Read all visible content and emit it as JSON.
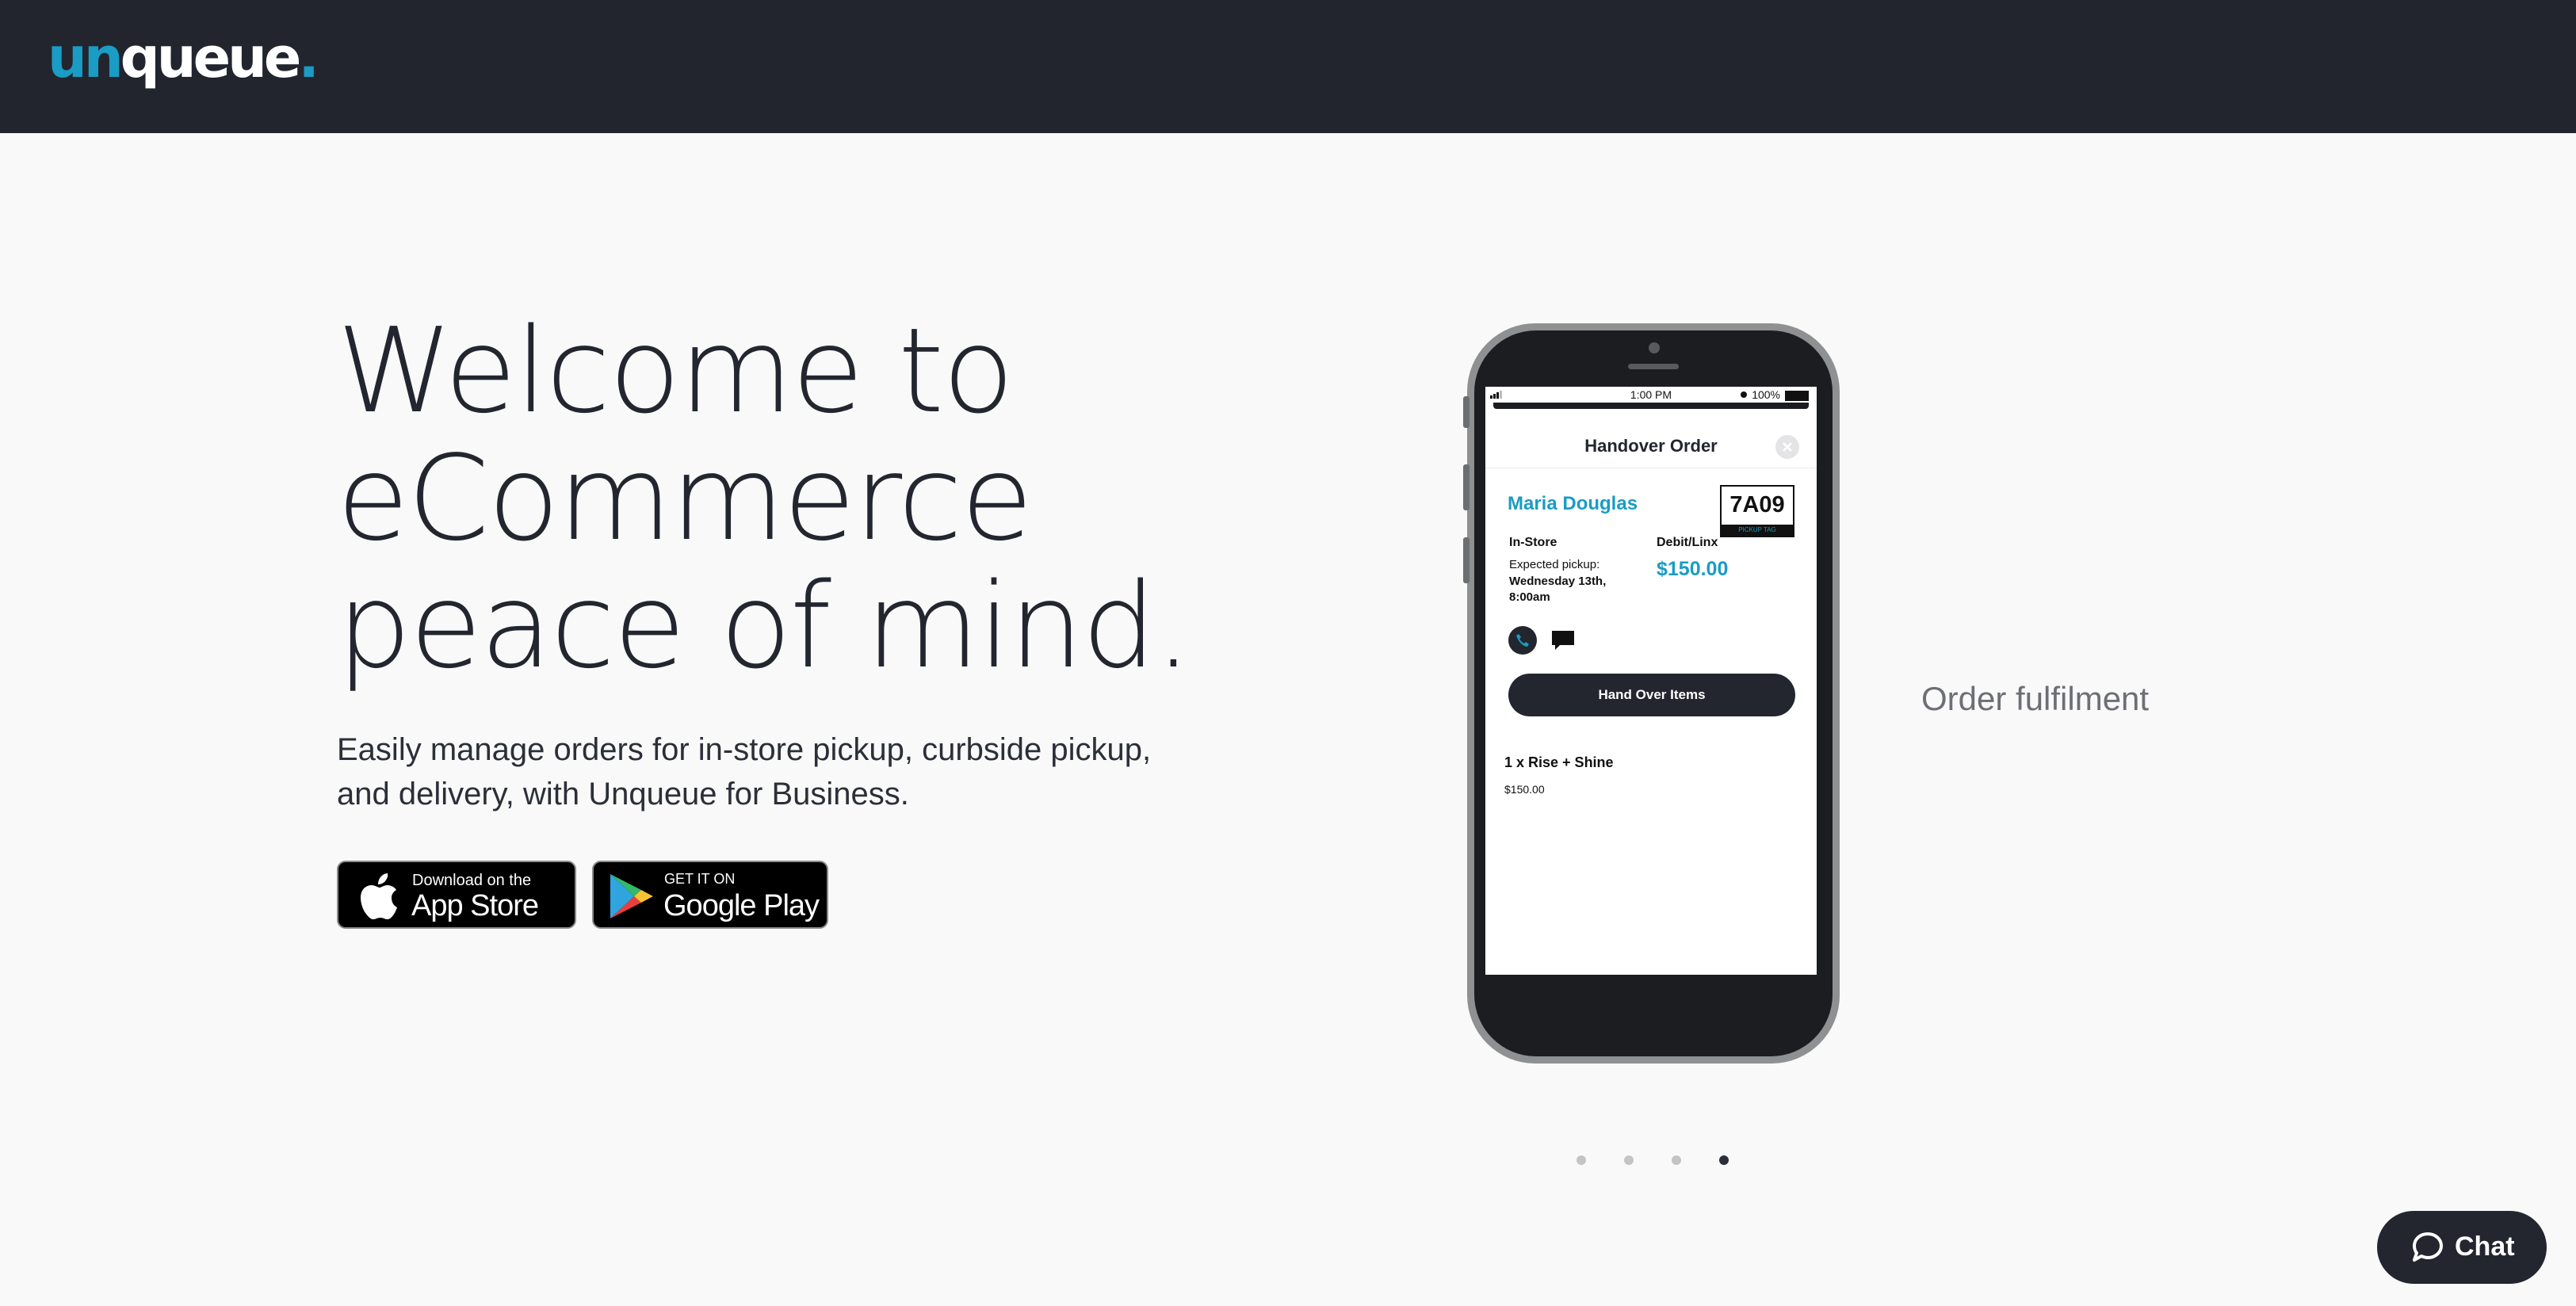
{
  "brand": {
    "logo_un": "un",
    "logo_queue": "queue",
    "logo_dot": ".",
    "accent_color": "#1a9cc4",
    "header_color": "#22252e"
  },
  "hero": {
    "headline_lines": [
      "Welcome to",
      "eCommerce",
      "peace of mind."
    ],
    "subtitle_lines": [
      "Easily manage orders for in-store pickup, curbside pickup,",
      "and delivery, with Unqueue for Business."
    ]
  },
  "store_buttons": {
    "apple_small": "Download on the",
    "apple_large": "App Store",
    "google_small": "GET IT ON",
    "google_large": "Google Play"
  },
  "phone_screen": {
    "status_time": "1:00 PM",
    "status_battery": "100%",
    "modal_title": "Handover Order",
    "customer_name": "Maria Douglas",
    "pickup_tag_code": "7A09",
    "pickup_tag_label": "PICKUP TAG",
    "fulfillment_method": "In-Store",
    "payment_method": "Debit/Linx",
    "expected_pickup_label": "Expected pickup:",
    "expected_pickup_value": "Wednesday 13th, 8:00am",
    "amount": "$150.00",
    "primary_action": "Hand Over Items",
    "item_name": "1 x Rise + Shine",
    "item_price": "$150.00"
  },
  "carousel": {
    "caption": "Order fulfilment",
    "slide_count": 4,
    "active_slide": 4
  },
  "chat": {
    "label": "Chat"
  }
}
